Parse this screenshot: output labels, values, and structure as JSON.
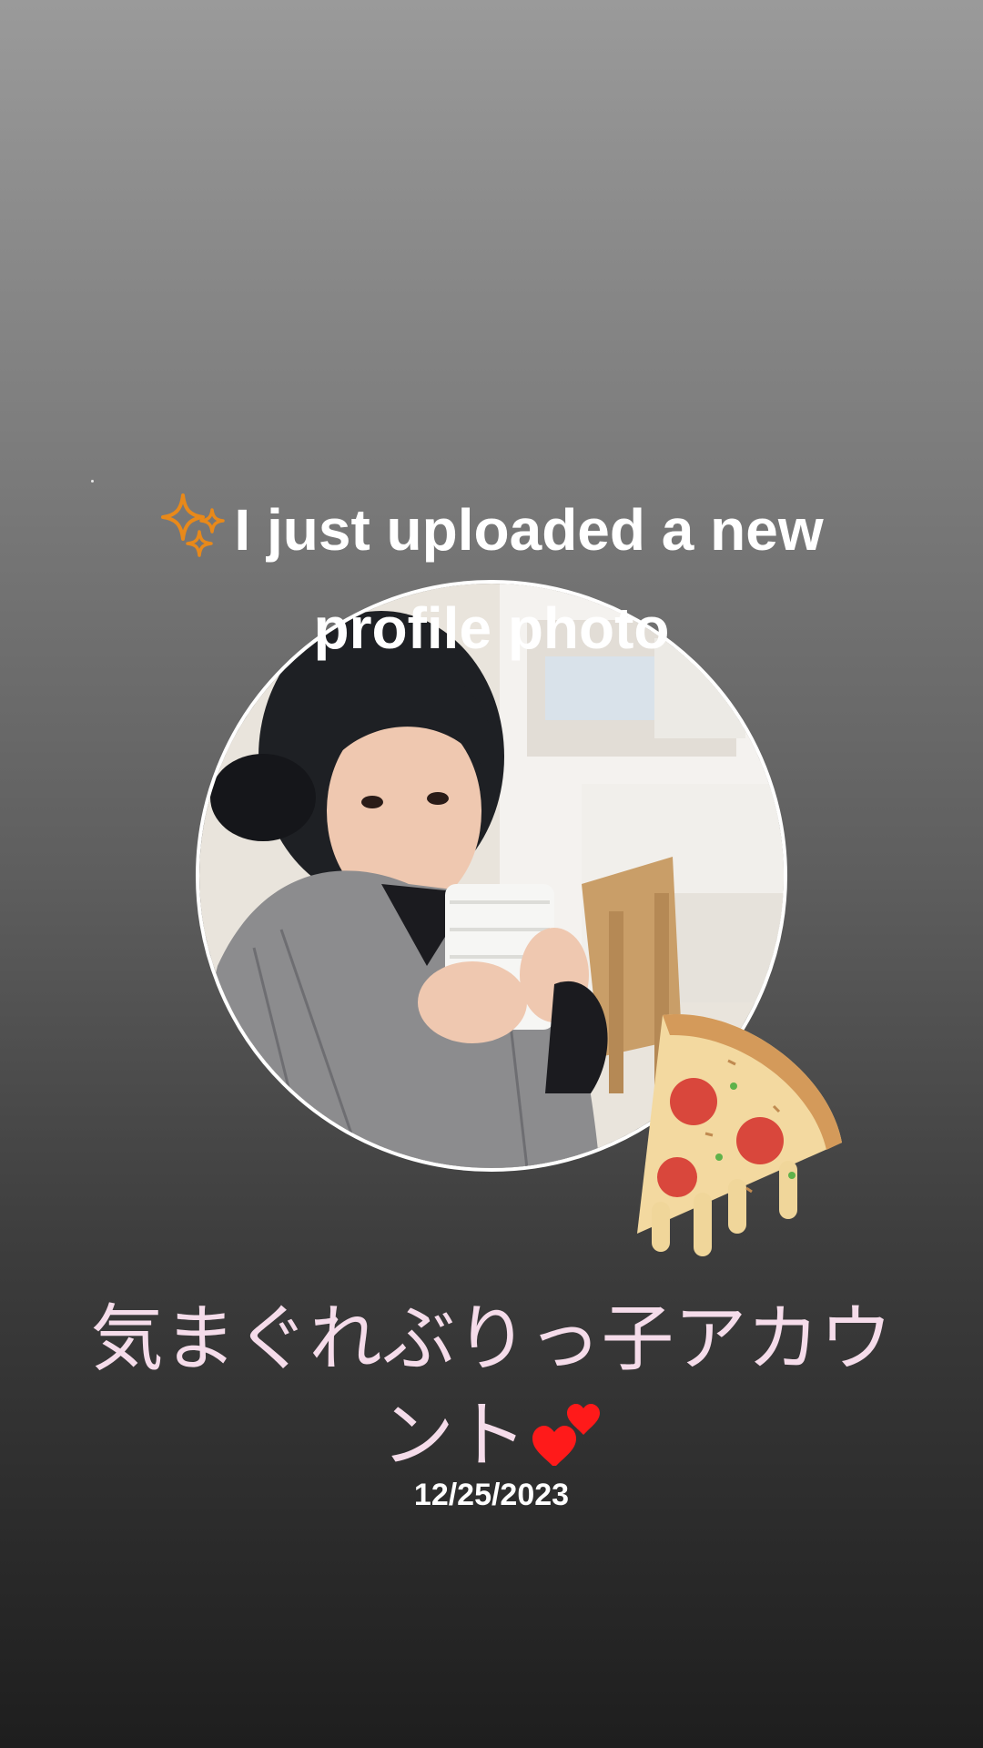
{
  "story": {
    "headline": "I just uploaded a new profile photo",
    "account_name": "気まぐれぶりっ子アカウント",
    "date": "12/25/2023"
  },
  "icons": {
    "headline_prefix": "sparkles-icon",
    "account_suffix": "two-hearts-icon",
    "sticker": "pizza-icon"
  },
  "colors": {
    "headline_text": "#ffffff",
    "account_text": "#f5dcea",
    "date_text": "#ffffff",
    "sparkle": "#e8891a",
    "heart": "#ff1a1a",
    "photo_border": "#ffffff"
  }
}
